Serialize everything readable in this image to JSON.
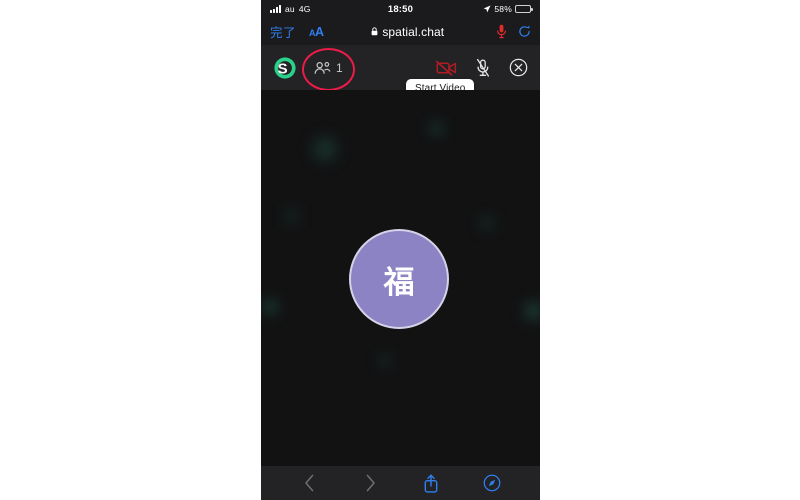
{
  "status_bar": {
    "carrier": "au",
    "network": "4G",
    "time": "18:50",
    "battery_percent": "58%",
    "signal_icon": "signal-bars-icon",
    "location_icon": "location-arrow-icon",
    "battery_icon": "battery-icon",
    "battery_level": 58
  },
  "browser": {
    "done_label": "完了",
    "text_size_label_small": "A",
    "text_size_label_large": "A",
    "lock_icon": "lock-icon",
    "url": "spatial.chat",
    "mic_icon": "microphone-icon",
    "reload_icon": "reload-icon",
    "bottom_bar": {
      "back_icon": "chevron-left-icon",
      "forward_icon": "chevron-right-icon",
      "share_icon": "share-icon",
      "tabs_icon": "compass-icon"
    }
  },
  "app": {
    "logo_icon": "spatialchat-logo-icon",
    "people_icon": "people-icon",
    "participant_count": "1",
    "video_icon": "video-off-icon",
    "mic_icon": "microphone-muted-icon",
    "close_icon": "close-icon",
    "tooltip": "Start Video",
    "annotation_icon": "red-highlight-ellipse"
  },
  "stage": {
    "avatar_initial": "福",
    "avatar_color": "#8c83c5",
    "avatar_border_color": "#d6d2e8",
    "background_color": "#121213"
  },
  "colors": {
    "accent_blue": "#2f7ff0",
    "brand_green": "#2ad18a",
    "alert_red": "#ec1b47",
    "video_off_red": "#b01b24",
    "toolbar_bg": "#232325"
  }
}
